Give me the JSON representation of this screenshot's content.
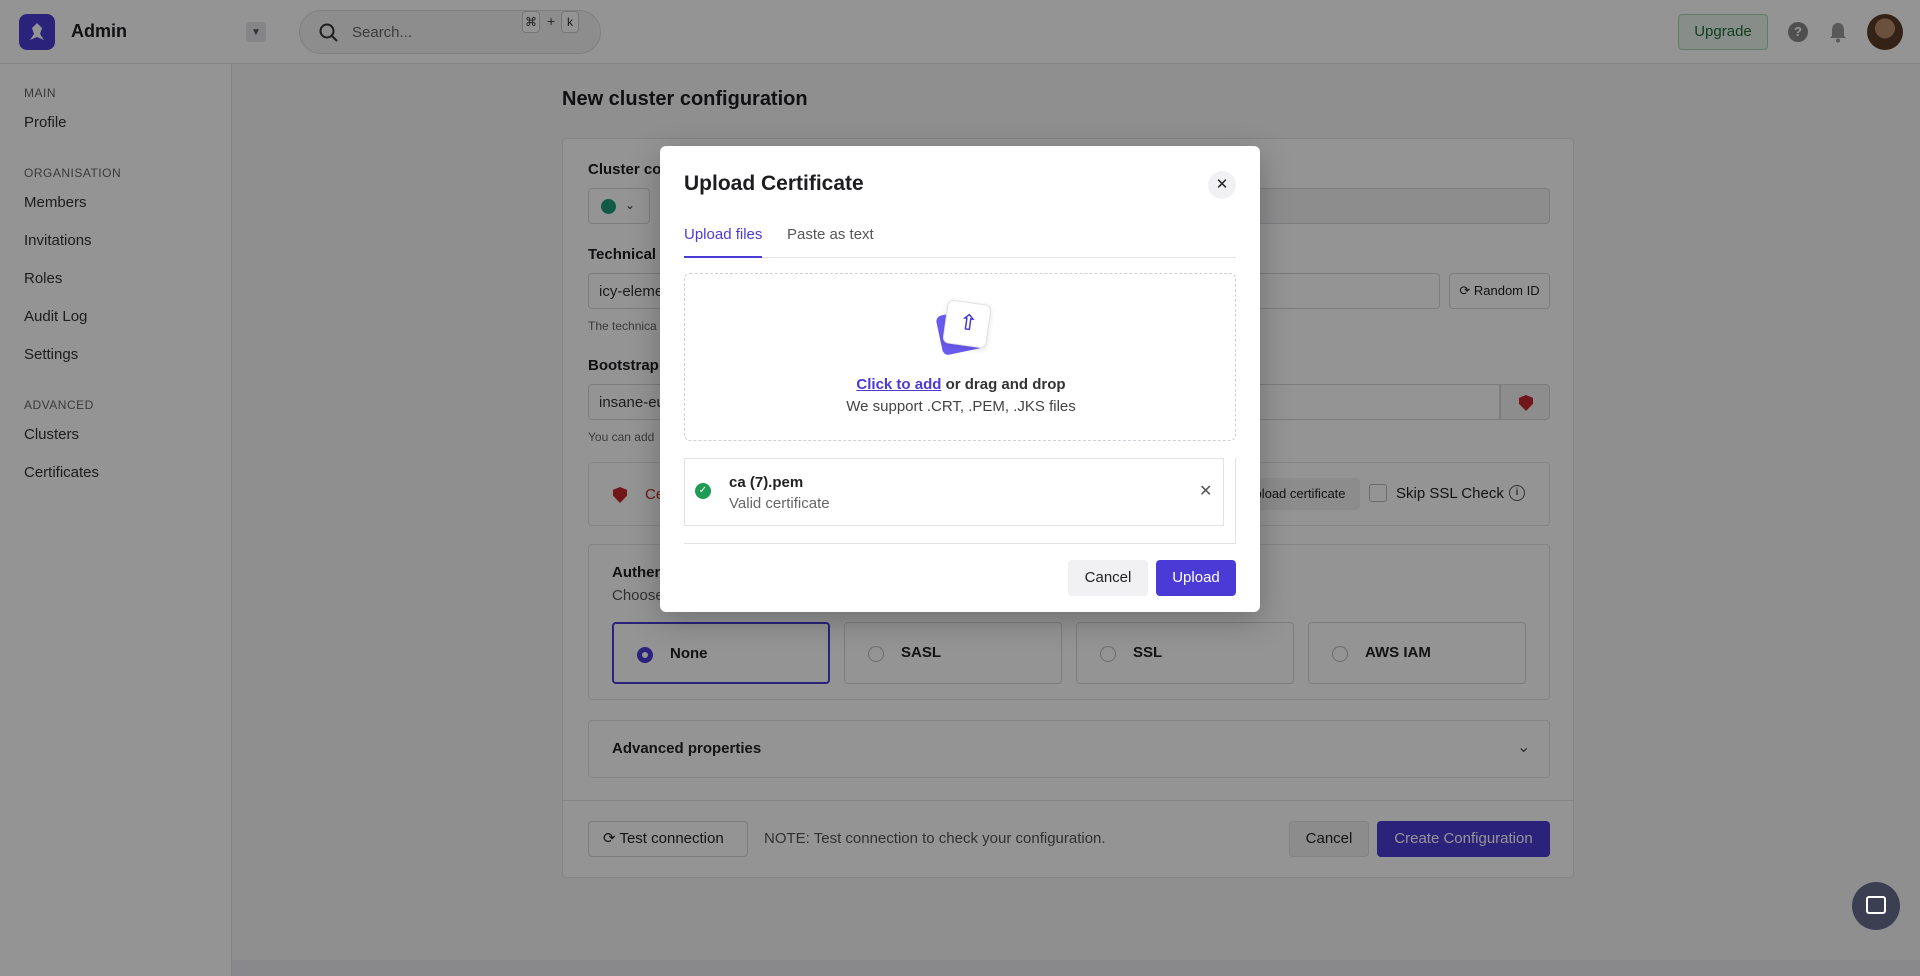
{
  "header": {
    "app_name": "Admin",
    "search_placeholder": "Search...",
    "shortcut_cmd": "⌘",
    "shortcut_plus": "+",
    "shortcut_key": "k",
    "upgrade_label": "Upgrade"
  },
  "sidebar": {
    "sections": [
      {
        "label": "MAIN",
        "items": [
          "Profile"
        ]
      },
      {
        "label": "ORGANISATION",
        "items": [
          "Members",
          "Invitations",
          "Roles",
          "Audit Log",
          "Settings"
        ]
      },
      {
        "label": "ADVANCED",
        "items": [
          "Clusters",
          "Certificates"
        ]
      }
    ]
  },
  "main": {
    "title": "New cluster configuration",
    "cluster_color_label": "Cluster co",
    "technical_label": "Technical I",
    "technical_value": "icy-eleme",
    "technical_hint": "The technica",
    "random_id_label": "Random ID",
    "bootstrap_label": "Bootstrap",
    "bootstrap_value": "insane-eu",
    "bootstrap_hint": "You can add",
    "cert_status": "Ce",
    "upload_certificate_label": "pload certificate",
    "skip_ssl_label": "Skip SSL Check",
    "auth_title": "Authen",
    "auth_hint": "Choose",
    "auth_options": [
      "None",
      "SASL",
      "SSL",
      "AWS IAM"
    ],
    "advanced_label": "Advanced properties",
    "test_connection_label": "Test connection",
    "note": "NOTE: Test connection to check your configuration.",
    "cancel_label": "Cancel",
    "create_label": "Create Configuration"
  },
  "modal": {
    "title": "Upload Certificate",
    "close_glyph": "✕",
    "tabs": [
      "Upload files",
      "Paste as text"
    ],
    "click_to_add": "Click to add",
    "drag_text": " or drag and drop",
    "support_text": "We support .CRT, .PEM, .JKS files",
    "file": {
      "name": "ca (7).pem",
      "status": "Valid certificate"
    },
    "cancel_label": "Cancel",
    "upload_label": "Upload"
  },
  "colors": {
    "accent": "#4b3bd6",
    "success": "#1e9c55",
    "danger": "#c3262b",
    "cluster_color": "#1e9c77"
  }
}
